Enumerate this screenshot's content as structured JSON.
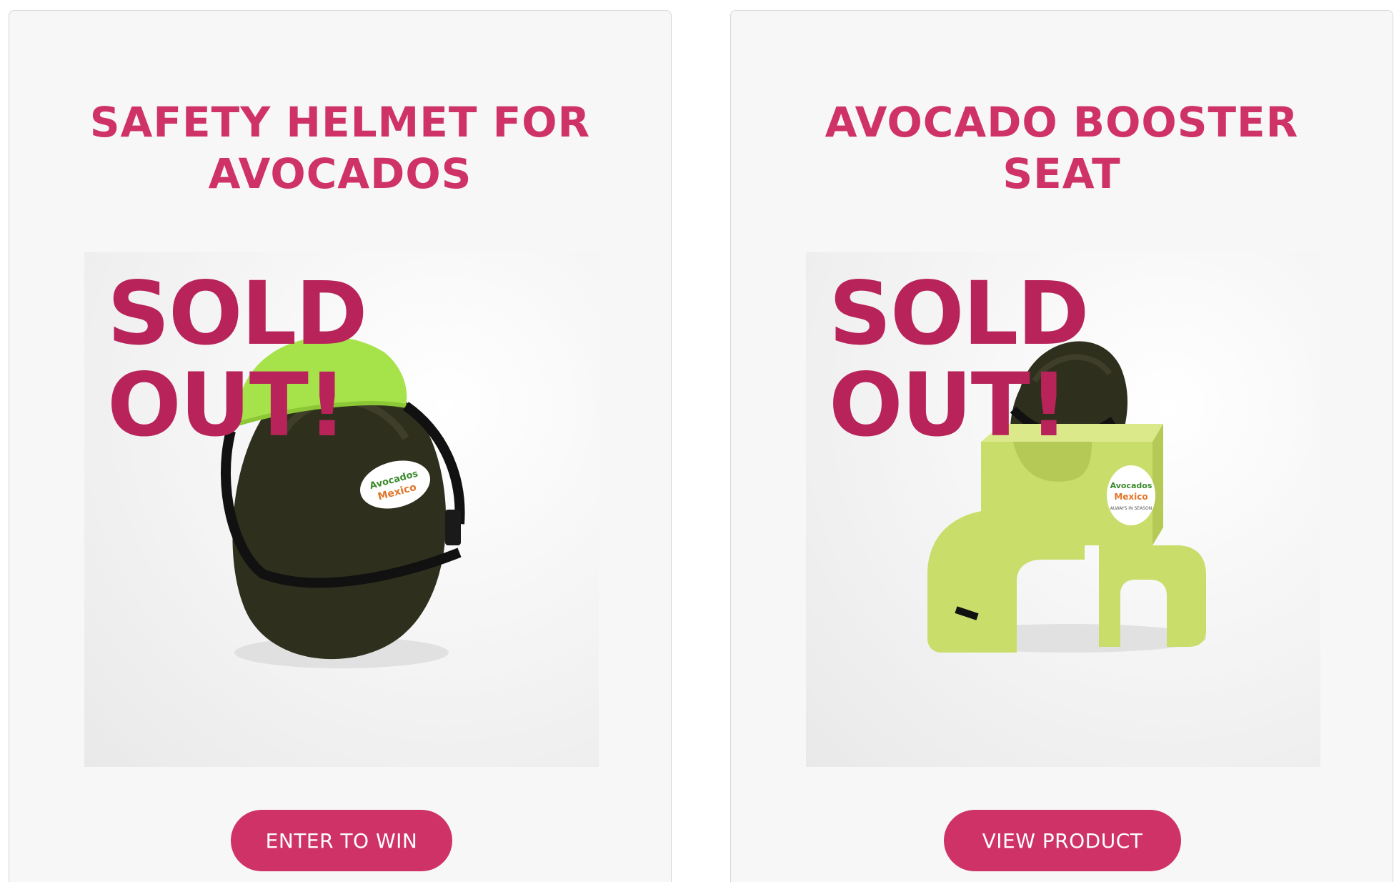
{
  "products": [
    {
      "title": "SAFETY HELMET FOR\nAVOCADOS",
      "badge": "SOLD\nOUT!",
      "image_icon": "avocado-helmet-photo",
      "button_label": "ENTER TO WIN"
    },
    {
      "title": "AVOCADO BOOSTER\nSEAT",
      "badge": "SOLD\nOUT!",
      "image_icon": "avocado-booster-seat-photo",
      "button_label": "VIEW PRODUCT"
    }
  ],
  "sticker": {
    "brand_top": "Avocados",
    "brand_bottom": "Mexico",
    "tagline": "ALWAYS IN SEASON"
  },
  "colors": {
    "accent": "#cf3266",
    "sold_out": "#b8245a",
    "card_bg": "#f7f7f7",
    "helmet_green": "#a6e24a",
    "seat_green": "#c9dd6a",
    "avocado_skin": "#2f2f1e"
  }
}
